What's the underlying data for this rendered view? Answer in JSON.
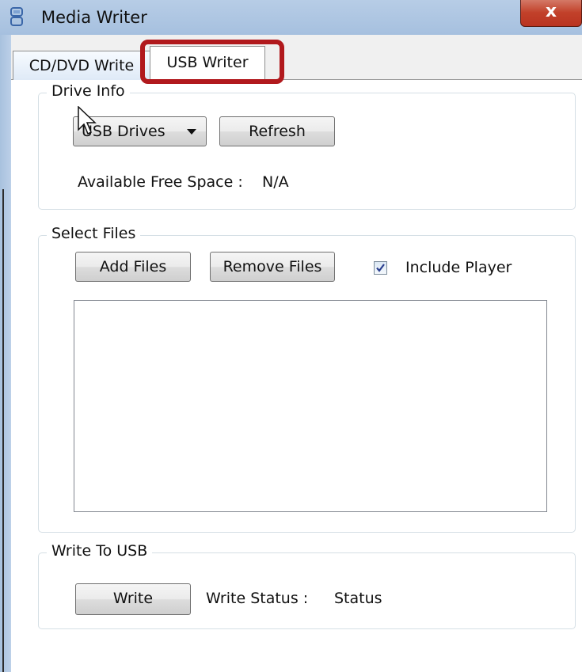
{
  "window": {
    "title": "Media Writer",
    "close_label": "x"
  },
  "tabs": [
    {
      "label": "CD/DVD Write",
      "selected": false
    },
    {
      "label": "USB Writer",
      "selected": true
    }
  ],
  "drive_info": {
    "group_title": "Drive Info",
    "drive_select": "USB Drives",
    "refresh_label": "Refresh",
    "free_space_label": "Available Free Space :",
    "free_space_value": "N/A"
  },
  "select_files": {
    "group_title": "Select Files",
    "add_label": "Add Files",
    "remove_label": "Remove Files",
    "include_player_label": "Include Player",
    "include_player_checked": true,
    "files": []
  },
  "write_usb": {
    "group_title": "Write To USB",
    "write_label": "Write",
    "status_label": "Write Status :",
    "status_value": "Status"
  },
  "colors": {
    "highlight": "#b1191d",
    "titlebar": "#b7cde6",
    "close": "#c2412a"
  }
}
